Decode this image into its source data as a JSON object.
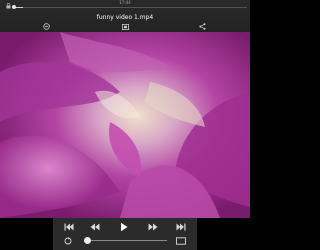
{
  "top": {
    "time": "17:44",
    "seek_progress": 0.03,
    "icons": {
      "lock": "lock-icon",
      "settings": "settings-icon",
      "share": "share-icon",
      "menu": "menu-icon",
      "screen": "screen-icon"
    }
  },
  "video": {
    "title": "funny video 1.mp4"
  },
  "controls": {
    "icons": [
      "skip-previous-icon",
      "rewind-icon",
      "play-icon",
      "fast-forward-icon",
      "skip-next-icon",
      "rotate-icon",
      "aspect-ratio-icon"
    ],
    "seek_progress": 0.05
  },
  "colors": {
    "accent": "#ffffff",
    "bar": "#2b2b2b",
    "video_main": "#b44aa8"
  }
}
